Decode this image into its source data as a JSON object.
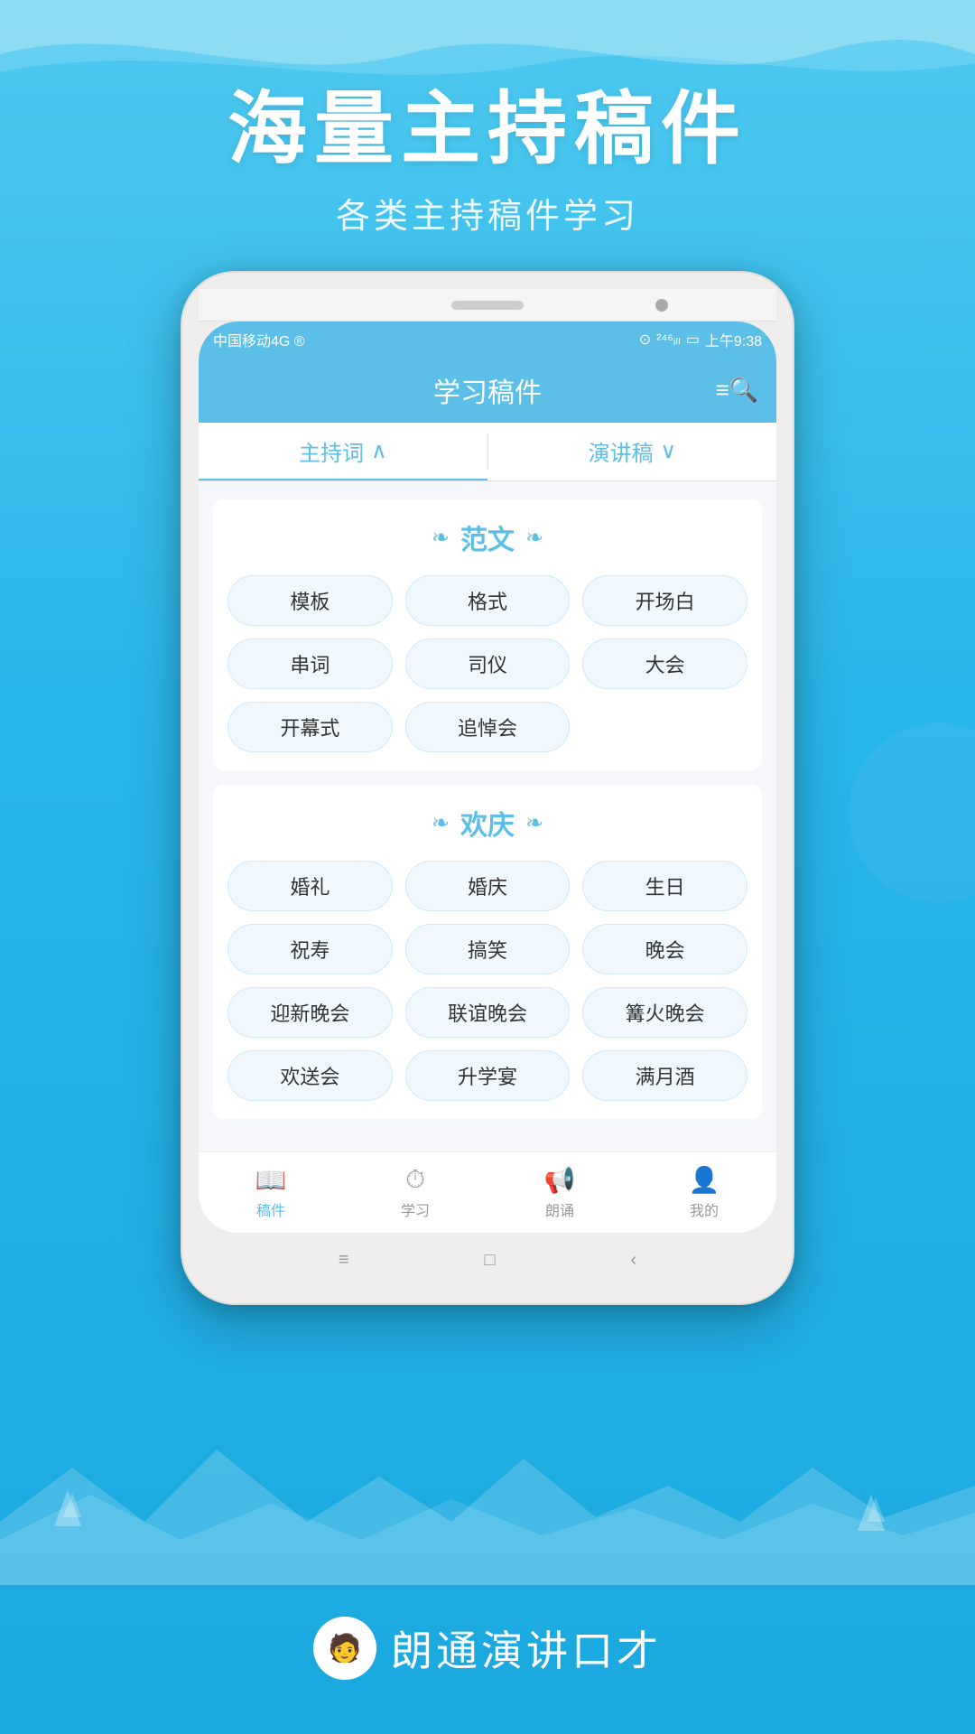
{
  "background": {
    "color_top": "#4ec9f0",
    "color_mid": "#29b6e8",
    "color_bottom": "#1aa8df"
  },
  "hero": {
    "title": "海量主持稿件",
    "subtitle": "各类主持稿件学习"
  },
  "phone": {
    "status_bar": {
      "carrier": "中国移动4G ®",
      "time": "上午9:38",
      "signal": "46"
    },
    "header": {
      "title": "学习稿件",
      "search_icon": "≡Q"
    },
    "tabs": [
      {
        "label": "主持词",
        "arrow": "∧",
        "active": true
      },
      {
        "label": "演讲稿",
        "arrow": "∨",
        "active": false
      }
    ],
    "sections": [
      {
        "title": "范文",
        "tags": [
          "模板",
          "格式",
          "开场白",
          "串词",
          "司仪",
          "大会",
          "开幕式",
          "追悼会"
        ]
      },
      {
        "title": "欢庆",
        "tags": [
          "婚礼",
          "婚庆",
          "生日",
          "祝寿",
          "搞笑",
          "晚会",
          "迎新晚会",
          "联谊晚会",
          "篝火晚会",
          "欢送会",
          "升学宴",
          "满月酒"
        ]
      }
    ],
    "bottom_nav": [
      {
        "icon": "📖",
        "label": "稿件",
        "active": true
      },
      {
        "icon": "⏰",
        "label": "学习",
        "active": false
      },
      {
        "icon": "📢",
        "label": "朗诵",
        "active": false
      },
      {
        "icon": "👤",
        "label": "我的",
        "active": false
      }
    ],
    "phone_buttons": [
      "≡",
      "□",
      "‹"
    ]
  },
  "branding": {
    "logo_emoji": "👦",
    "text": "朗通演讲口才"
  }
}
